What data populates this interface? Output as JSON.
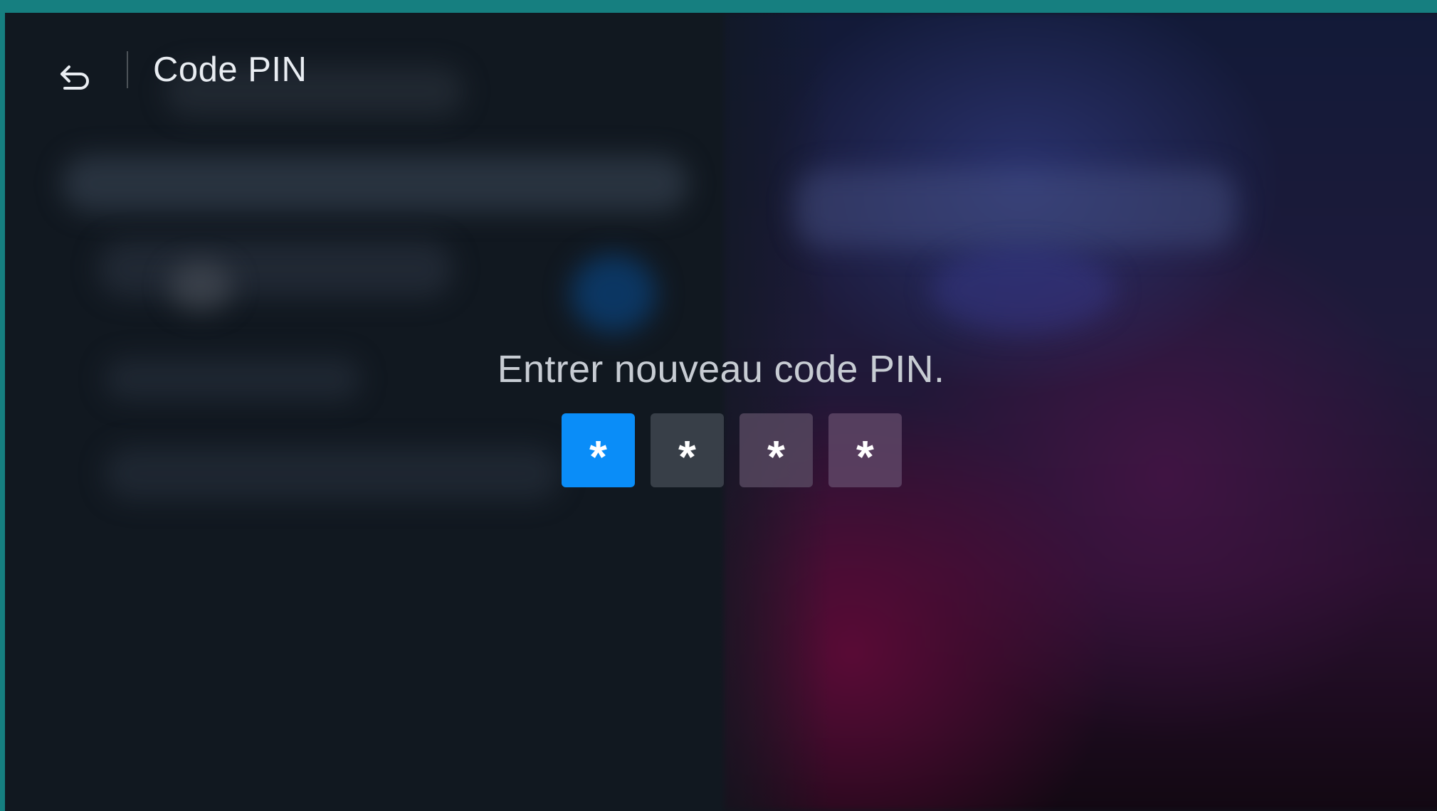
{
  "header": {
    "title": "Code PIN",
    "back_icon": "back-arrow-icon"
  },
  "pin_entry": {
    "prompt": "Entrer nouveau code PIN.",
    "digits": [
      "*",
      "*",
      "*",
      "*"
    ],
    "active_index": 0
  },
  "colors": {
    "accent": "#0a8df8",
    "frame_border": "#167f80",
    "background": "#111820"
  }
}
